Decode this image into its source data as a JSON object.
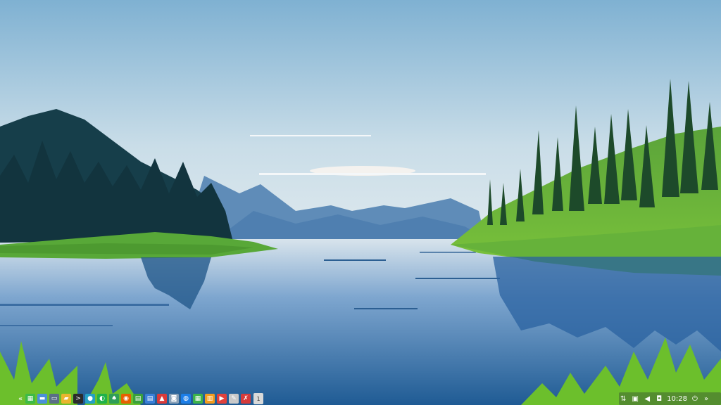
{
  "taskbar": {
    "left_arrow": "«",
    "apps": [
      {
        "name": "spreadsheet-app-icon",
        "color": "#3dbb47",
        "glyph": "▦"
      },
      {
        "name": "folder-app-icon",
        "color": "#4a90d9",
        "glyph": "▬"
      },
      {
        "name": "window-app-icon",
        "color": "#5a6f86",
        "glyph": "▭"
      },
      {
        "name": "files-app-icon",
        "color": "#e8b52e",
        "glyph": "▰"
      },
      {
        "name": "terminal-app-icon",
        "color": "#2b2b2b",
        "glyph": ">"
      },
      {
        "name": "network-app-icon",
        "color": "#25a0c5",
        "glyph": "●"
      },
      {
        "name": "whatsapp-app-icon",
        "color": "#20b24a",
        "glyph": "◐"
      },
      {
        "name": "cards-app-icon",
        "color": "#2f9e57",
        "glyph": "♠"
      },
      {
        "name": "firefox-app-icon",
        "color": "#e66000",
        "glyph": "◉"
      },
      {
        "name": "document-app-icon",
        "color": "#3aa13a",
        "glyph": "▤"
      },
      {
        "name": "writer-app-icon",
        "color": "#3a7fd8",
        "glyph": "▤"
      },
      {
        "name": "pdf-app-icon",
        "color": "#d93a3a",
        "glyph": "▲"
      },
      {
        "name": "archive-app-icon",
        "color": "#8aa1b8",
        "glyph": "◙"
      },
      {
        "name": "browser-app-icon",
        "color": "#1c7ee8",
        "glyph": "◍"
      },
      {
        "name": "calc-app-icon",
        "color": "#3db34a",
        "glyph": "▦"
      },
      {
        "name": "impress-app-icon",
        "color": "#f29c1f",
        "glyph": "▥"
      },
      {
        "name": "media-app-icon",
        "color": "#e0413c",
        "glyph": "▶"
      },
      {
        "name": "editor-app-icon",
        "color": "#c9c9c9",
        "glyph": "✎"
      },
      {
        "name": "tools-app-icon",
        "color": "#d53a3a",
        "glyph": "✗"
      }
    ],
    "workspace_label": "1",
    "tray": {
      "network_glyph": "⇅",
      "display_glyph": "▣",
      "volume_glyph": "◀",
      "screenshot_glyph": "◘",
      "clock": "10:28",
      "power_glyph": "⏻",
      "right_arrow": "»"
    }
  }
}
